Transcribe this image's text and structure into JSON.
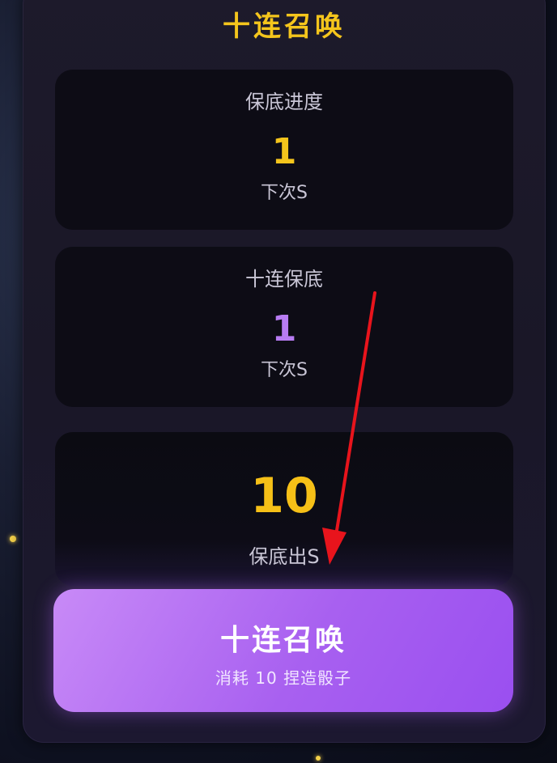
{
  "panel": {
    "title": "十连召唤"
  },
  "pity_progress": {
    "label": "保底进度",
    "value": "1",
    "sub": "下次S"
  },
  "ten_pull_pity": {
    "label": "十连保底",
    "value": "1",
    "sub": "下次S"
  },
  "guarantee": {
    "value": "10",
    "sub": "保底出S"
  },
  "summon_button": {
    "label": "十连召唤",
    "cost": "消耗 10 捏造骰子"
  },
  "colors": {
    "gold": "#f4c51c",
    "purple_value": "#b77cf2",
    "button": "#a860f0",
    "annotation_arrow": "#e8141c"
  },
  "icons": {
    "annotation": "red-arrow-icon"
  }
}
